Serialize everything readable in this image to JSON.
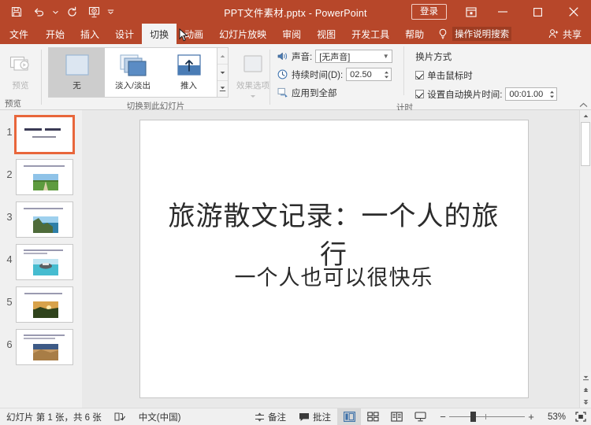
{
  "titlebar": {
    "quick_access": [
      {
        "name": "save-icon",
        "label": "保存"
      },
      {
        "name": "undo-icon",
        "label": "撤消"
      },
      {
        "name": "redo-icon",
        "label": "重复"
      },
      {
        "name": "start-slideshow-icon",
        "label": "从头开始"
      },
      {
        "name": "customize-qat-icon",
        "label": "自定义快速访问工具栏"
      }
    ],
    "document_title": "PPT文件素材.pptx",
    "app_separator": "-",
    "app_name": "PowerPoint",
    "sign_in": "登录",
    "ribbon_display_options": "功能区显示选项",
    "minimize": "最小化",
    "maximize": "最大化",
    "close": "关闭"
  },
  "tabs": [
    {
      "label": "文件",
      "active": false
    },
    {
      "label": "开始",
      "active": false
    },
    {
      "label": "插入",
      "active": false
    },
    {
      "label": "设计",
      "active": false
    },
    {
      "label": "切换",
      "active": true
    },
    {
      "label": "动画",
      "active": false
    },
    {
      "label": "幻灯片放映",
      "active": false
    },
    {
      "label": "审阅",
      "active": false
    },
    {
      "label": "视图",
      "active": false
    },
    {
      "label": "开发工具",
      "active": false
    },
    {
      "label": "帮助",
      "active": false
    }
  ],
  "tell_me": "操作说明搜索",
  "share": "共享",
  "ribbon": {
    "preview_group": {
      "button_label": "预览",
      "group_label": "预览"
    },
    "transition_group": {
      "group_label": "切换到此幻灯片",
      "items": [
        {
          "label": "无",
          "selected": true
        },
        {
          "label": "淡入/淡出",
          "selected": false
        },
        {
          "label": "推入",
          "selected": false
        }
      ],
      "effect_options_label": "效果选项"
    },
    "timing_group": {
      "group_label": "计时",
      "sound_label": "声音:",
      "sound_value": "[无声音]",
      "duration_label": "持续时间(D):",
      "duration_value": "02.50",
      "apply_all_label": "应用到全部",
      "advance_heading": "换片方式",
      "on_click_label": "单击鼠标时",
      "on_click_checked": true,
      "after_label": "设置自动换片时间:",
      "after_checked": true,
      "after_value": "00:01.00"
    },
    "collapse_label": "折叠功能区"
  },
  "thumbnails": [
    {
      "number": "1",
      "selected": true,
      "has_image": false
    },
    {
      "number": "2",
      "selected": false,
      "has_image": true,
      "image": "road-field"
    },
    {
      "number": "3",
      "selected": false,
      "has_image": true,
      "image": "coast-cliff"
    },
    {
      "number": "4",
      "selected": false,
      "has_image": true,
      "image": "boat-sea"
    },
    {
      "number": "5",
      "selected": false,
      "has_image": true,
      "image": "sunset-hill"
    },
    {
      "number": "6",
      "selected": false,
      "has_image": true,
      "image": "desert-dune"
    }
  ],
  "slide": {
    "title": "旅游散文记录：一个人的旅行",
    "subtitle": "一个人也可以很快乐"
  },
  "status": {
    "slide_count_text": "幻灯片 第 1 张，共 6 张",
    "spellcheck_icon_label": "拼写检查",
    "language": "中文(中国)",
    "notes": "备注",
    "comments": "批注",
    "views": [
      {
        "name": "normal-view",
        "label": "普通视图",
        "active": true
      },
      {
        "name": "slide-sorter-view",
        "label": "幻灯片浏览",
        "active": false
      },
      {
        "name": "reading-view",
        "label": "阅读视图",
        "active": false
      },
      {
        "name": "slideshow-view",
        "label": "幻灯片放映",
        "active": false
      }
    ],
    "zoom_out": "−",
    "zoom_in": "+",
    "zoom_level": "53%",
    "fit_label": "使幻灯片适应当前窗口"
  },
  "colors": {
    "brand": "#b7472a",
    "selection": "#e8663b",
    "ribbon_bg": "#f3f3f3",
    "workspace": "#e9e9e9"
  }
}
